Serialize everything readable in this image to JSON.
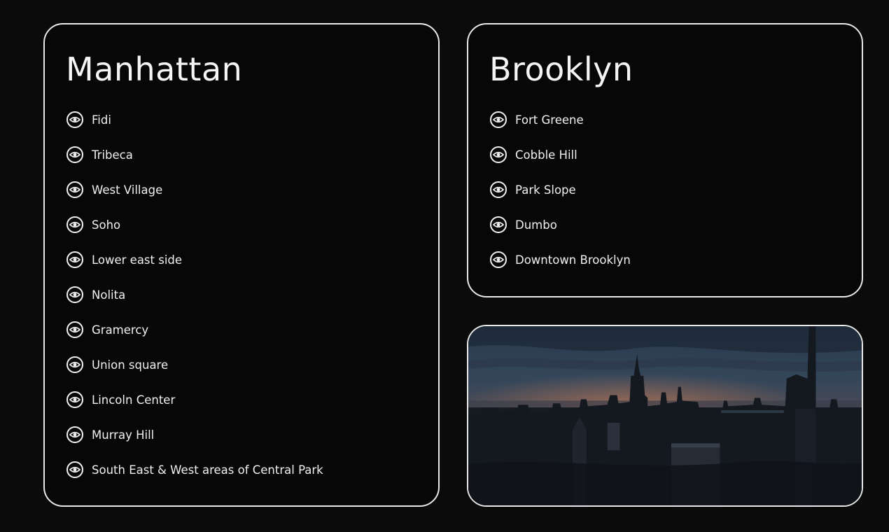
{
  "manhattan": {
    "title": "Manhattan",
    "items": [
      {
        "label": "Fidi",
        "icon": "eye-icon"
      },
      {
        "label": "Tribeca",
        "icon": "eye-icon"
      },
      {
        "label": "West Village",
        "icon": "eye-icon"
      },
      {
        "label": "Soho",
        "icon": "eye-icon"
      },
      {
        "label": "Lower east side",
        "icon": "eye-icon"
      },
      {
        "label": "Nolita",
        "icon": "eye-icon"
      },
      {
        "label": "Gramercy",
        "icon": "eye-icon"
      },
      {
        "label": "Union square",
        "icon": "eye-icon"
      },
      {
        "label": "Lincoln Center",
        "icon": "eye-icon"
      },
      {
        "label": "Murray Hill",
        "icon": "eye-icon"
      },
      {
        "label": "South East & West areas of Central Park",
        "icon": "eye-icon"
      }
    ]
  },
  "brooklyn": {
    "title": "Brooklyn",
    "items": [
      {
        "label": "Fort Greene",
        "icon": "eye-icon"
      },
      {
        "label": "Cobble Hill",
        "icon": "eye-icon"
      },
      {
        "label": "Park Slope",
        "icon": "eye-icon"
      },
      {
        "label": "Dumbo",
        "icon": "eye-icon"
      },
      {
        "label": "Downtown Brooklyn",
        "icon": "eye-icon"
      }
    ]
  },
  "theme": {
    "background": "#0b0b0b",
    "card_border": "#e9e9e9",
    "text": "#f2f2f2",
    "sunset": "#e07a4f"
  }
}
